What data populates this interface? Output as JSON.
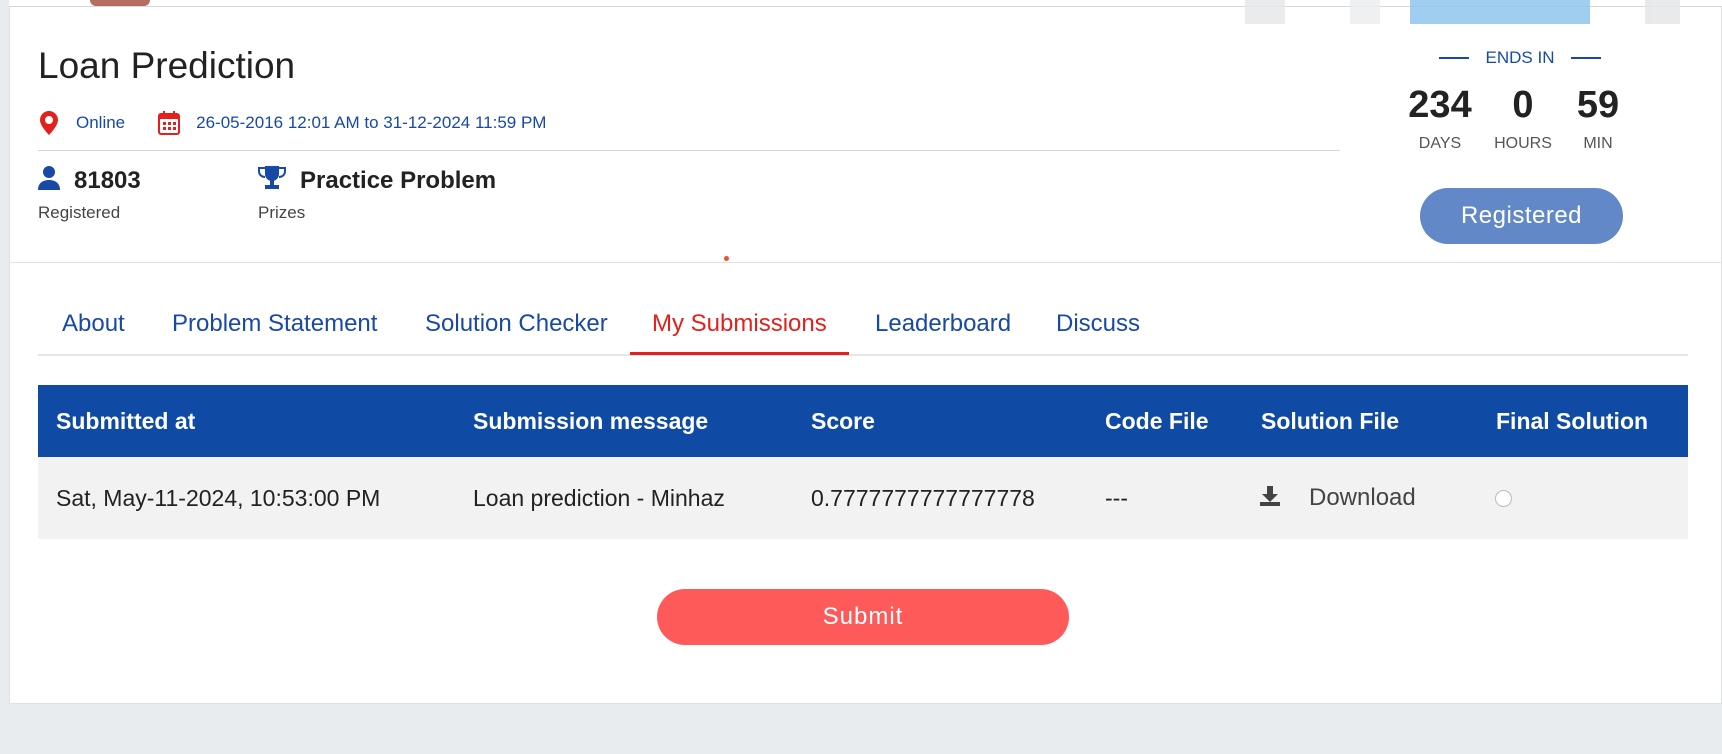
{
  "competition": {
    "title": "Loan Prediction",
    "mode": "Online",
    "date_range": "26-05-2016 12:01 AM to 31-12-2024 11:59 PM",
    "registered_count": "81803",
    "registered_label": "Registered",
    "prize_value": "Practice Problem",
    "prize_label": "Prizes"
  },
  "countdown": {
    "heading": "ENDS IN",
    "days": "234",
    "days_label": "DAYS",
    "hours": "0",
    "hours_label": "HOURS",
    "minutes": "59",
    "minutes_label": "MIN"
  },
  "registered_button": "Registered",
  "tabs": [
    {
      "label": "About"
    },
    {
      "label": "Problem Statement"
    },
    {
      "label": "Solution Checker"
    },
    {
      "label": "My Submissions",
      "active": true
    },
    {
      "label": "Leaderboard"
    },
    {
      "label": "Discuss"
    }
  ],
  "table": {
    "headers": [
      "Submitted at",
      "Submission message",
      "Score",
      "Code File",
      "Solution File",
      "Final Solution"
    ],
    "rows": [
      {
        "submitted_at": "Sat, May-11-2024, 10:53:00 PM",
        "message": "Loan prediction - Minhaz",
        "score": "0.7777777777777778",
        "code_file": "---",
        "solution_file": "Download",
        "final_solution_selected": false
      }
    ]
  },
  "submit_button": "Submit",
  "colors": {
    "primary_blue": "#1949a6",
    "header_blue": "#0f4aa5",
    "active_red": "#e3201c",
    "submit_red": "#ff5a5a",
    "registered_btn": "#6288c7"
  },
  "icons": {
    "location": "map-pin-icon",
    "calendar": "calendar-icon",
    "user": "user-icon",
    "trophy": "trophy-icon",
    "download": "download-icon"
  }
}
